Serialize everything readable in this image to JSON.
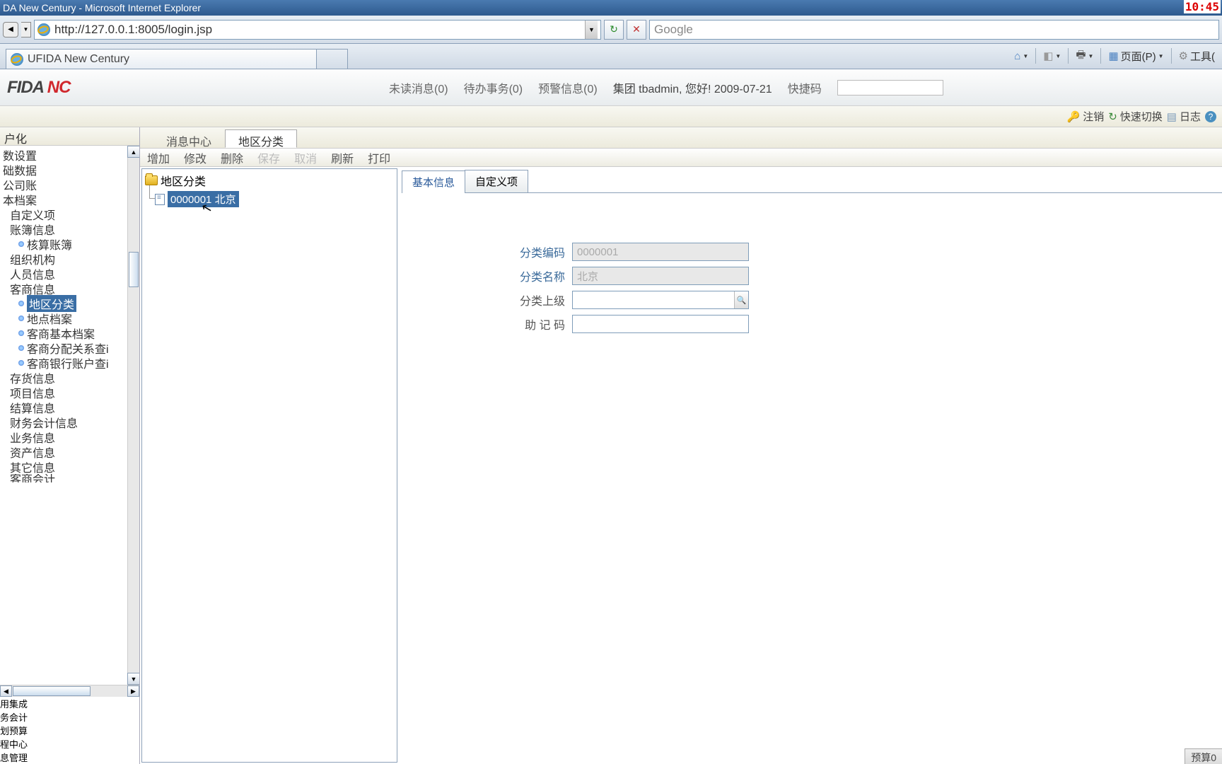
{
  "clock": "10:45",
  "window_title": "DA New Century - Microsoft Internet Explorer",
  "url": "http://127.0.0.1:8005/login.jsp",
  "search_placeholder": "Google",
  "ie_tab": "UFIDA New Century",
  "ie_tools": {
    "page": "页面(P)",
    "tools": "工具("
  },
  "logo_a": "FIDA ",
  "logo_b": "NC",
  "header": {
    "unread": "未读消息(0)",
    "todo": "待办事务(0)",
    "alert": "预警信息(0)",
    "greet": "集团 tbadmin, 您好! 2009-07-21",
    "quick": "快捷码"
  },
  "subtool": {
    "logout": "注销",
    "switch": "快速切换",
    "log": "日志"
  },
  "nav_header": "户化",
  "nav": [
    {
      "t": "数设置",
      "cls": ""
    },
    {
      "t": "础数据",
      "cls": ""
    },
    {
      "t": "公司账",
      "cls": ""
    },
    {
      "t": "本档案",
      "cls": ""
    },
    {
      "t": "自定义项",
      "cls": "ind1"
    },
    {
      "t": "账簿信息",
      "cls": "ind1"
    },
    {
      "t": "核算账簿",
      "cls": "ind2 dot"
    },
    {
      "t": "组织机构",
      "cls": "ind1"
    },
    {
      "t": "人员信息",
      "cls": "ind1"
    },
    {
      "t": "客商信息",
      "cls": "ind1"
    },
    {
      "t": "地区分类",
      "cls": "ind2 dot sel"
    },
    {
      "t": "地点档案",
      "cls": "ind2 dot"
    },
    {
      "t": "客商基本档案",
      "cls": "ind2 dot"
    },
    {
      "t": "客商分配关系查i",
      "cls": "ind2 dot"
    },
    {
      "t": "客商银行账户查i",
      "cls": "ind2 dot"
    },
    {
      "t": "存货信息",
      "cls": "ind1"
    },
    {
      "t": "项目信息",
      "cls": "ind1"
    },
    {
      "t": "结算信息",
      "cls": "ind1"
    },
    {
      "t": "财务会计信息",
      "cls": "ind1"
    },
    {
      "t": "业务信息",
      "cls": "ind1"
    },
    {
      "t": "资产信息",
      "cls": "ind1"
    },
    {
      "t": "其它信息",
      "cls": "ind1"
    },
    {
      "t": "客商会计",
      "cls": "ind1",
      "cut": true
    }
  ],
  "nav_sections": [
    "用集成",
    "务会计",
    "划预算",
    "程中心",
    "息管理"
  ],
  "content_tabs": [
    "消息中心",
    "地区分类"
  ],
  "content_tabs_active": 1,
  "toolbar": {
    "add": "增加",
    "edit": "修改",
    "del": "删除",
    "save": "保存",
    "cancel": "取消",
    "refresh": "刷新",
    "print": "打印"
  },
  "tree": {
    "root": "地区分类",
    "child": "0000001 北京"
  },
  "form_tabs": [
    "基本信息",
    "自定义项"
  ],
  "form": {
    "code_l": "分类编码",
    "code_v": "0000001",
    "name_l": "分类名称",
    "name_v": "北京",
    "parent_l": "分类上级",
    "parent_v": "",
    "mnemonic_l": "助 记 码",
    "mnemonic_v": ""
  },
  "status": "预算0"
}
